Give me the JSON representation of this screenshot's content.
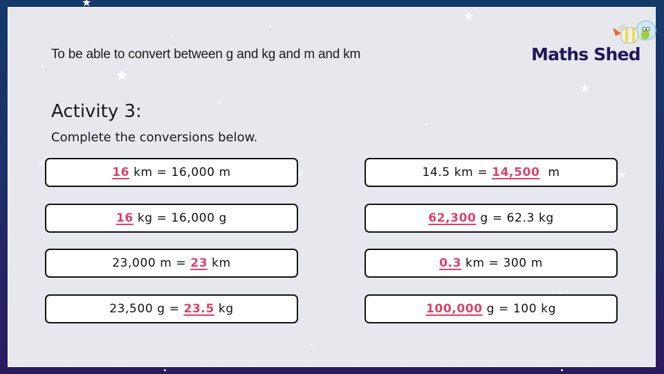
{
  "header": {
    "objective": "To be able to convert between g and kg and m and km",
    "logo_text": "Maths Shed",
    "logo_icon": "rocket-mascot-icon"
  },
  "activity": {
    "title": "Activity 3:",
    "instruction": "Complete the conversions below."
  },
  "colors": {
    "answer": "#d9436c",
    "frame_top": "#143a6a",
    "frame_bottom": "#2c1a5e",
    "panel": "#e6e8ee",
    "logo": "#23175a"
  },
  "conversions": [
    {
      "answer": "16",
      "rest": " km = 16,000 m",
      "answer_first": true
    },
    {
      "prefix": "14.5 km = ",
      "answer": "14,500",
      "rest": "  m",
      "answer_first": false
    },
    {
      "answer": "16",
      "rest": " kg = 16,000 g",
      "answer_first": true
    },
    {
      "answer": "62,300",
      "rest": " g = 62.3 kg",
      "answer_first": true
    },
    {
      "prefix": "23,000 m = ",
      "answer": "23",
      "rest": " km",
      "answer_first": false
    },
    {
      "answer": "0.3",
      "rest": " km = 300 m",
      "answer_first": true
    },
    {
      "prefix": "23,500 g = ",
      "answer": "23.5",
      "rest": " kg",
      "answer_first": false
    },
    {
      "answer": "100,000",
      "rest": " g = 100 kg",
      "answer_first": true
    }
  ]
}
